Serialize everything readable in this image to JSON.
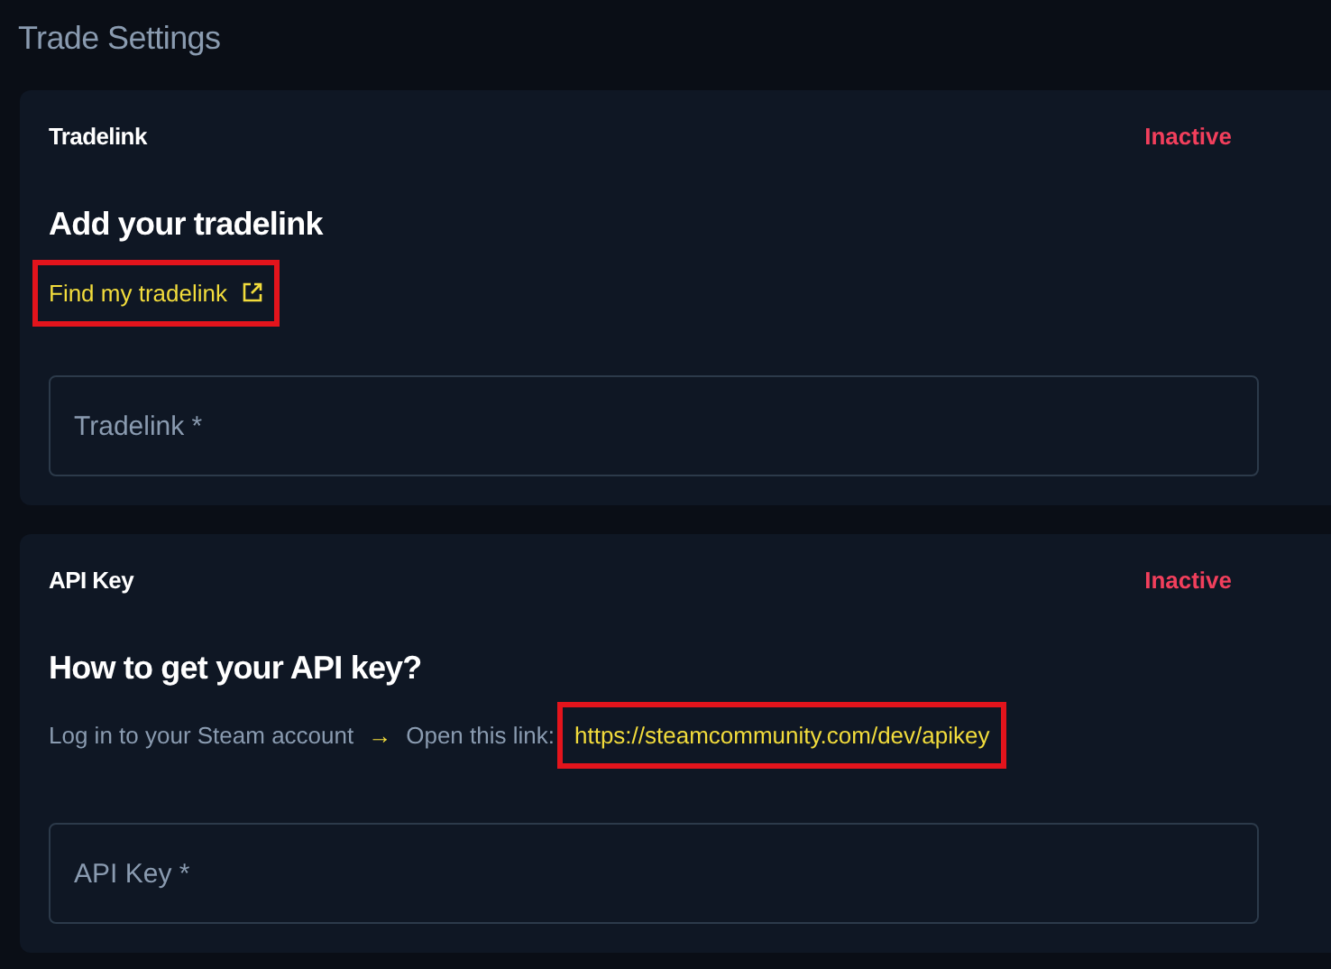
{
  "page": {
    "title": "Trade Settings"
  },
  "sections": [
    {
      "kind": "link",
      "label": "Tradelink",
      "status": "Inactive",
      "active": false,
      "heading": "Add your tradelink",
      "link": {
        "text": "Find my tradelink",
        "external": true,
        "highlighted": true
      },
      "field": {
        "placeholder": "Tradelink *"
      }
    },
    {
      "kind": "steps",
      "label": "API Key",
      "status": "Inactive",
      "active": false,
      "heading": "How to get your API key?",
      "steps": [
        "Log in to your Steam account",
        "Open this link:"
      ],
      "separator": "→",
      "link": {
        "text": "https://steamcommunity.com/dev/apikey",
        "external": false,
        "highlighted": true
      },
      "field": {
        "placeholder": "API Key *"
      }
    }
  ]
}
